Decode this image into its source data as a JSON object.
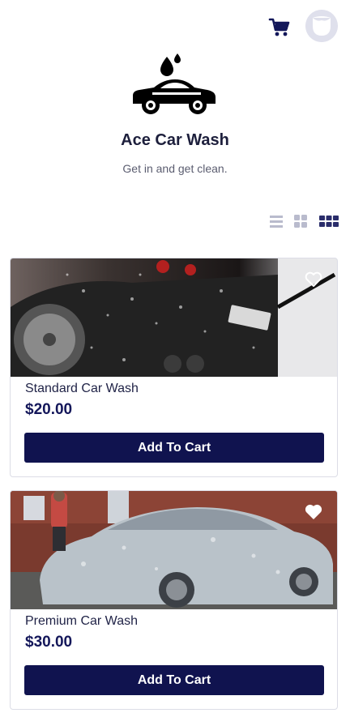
{
  "header": {
    "cart_icon": "cart-icon",
    "avatar_icon": "user-avatar"
  },
  "brand": {
    "title": "Ace Car Wash",
    "tagline": "Get in and get clean.",
    "logo_icon": "car-with-water-drops-logo"
  },
  "view_toggles": [
    {
      "icon": "list-view-icon",
      "active": false
    },
    {
      "icon": "small-grid-icon",
      "active": false
    },
    {
      "icon": "large-grid-icon",
      "active": true
    }
  ],
  "products": [
    {
      "name": "Standard Car Wash",
      "price": "$20.00",
      "button_label": "Add To Cart",
      "favorite_icon": "heart-outline-icon",
      "image": "dark sports car being pressure washed"
    },
    {
      "name": "Premium Car Wash",
      "price": "$30.00",
      "button_label": "Add To Cart",
      "favorite_icon": "heart-filled-icon",
      "image": "sedan covered in foam"
    }
  ],
  "colors": {
    "primary": "#10134f",
    "text": "#1f2246",
    "muted": "#5b5d70",
    "toggle_inactive": "#b9bbcd",
    "toggle_active": "#2a2d6b"
  }
}
